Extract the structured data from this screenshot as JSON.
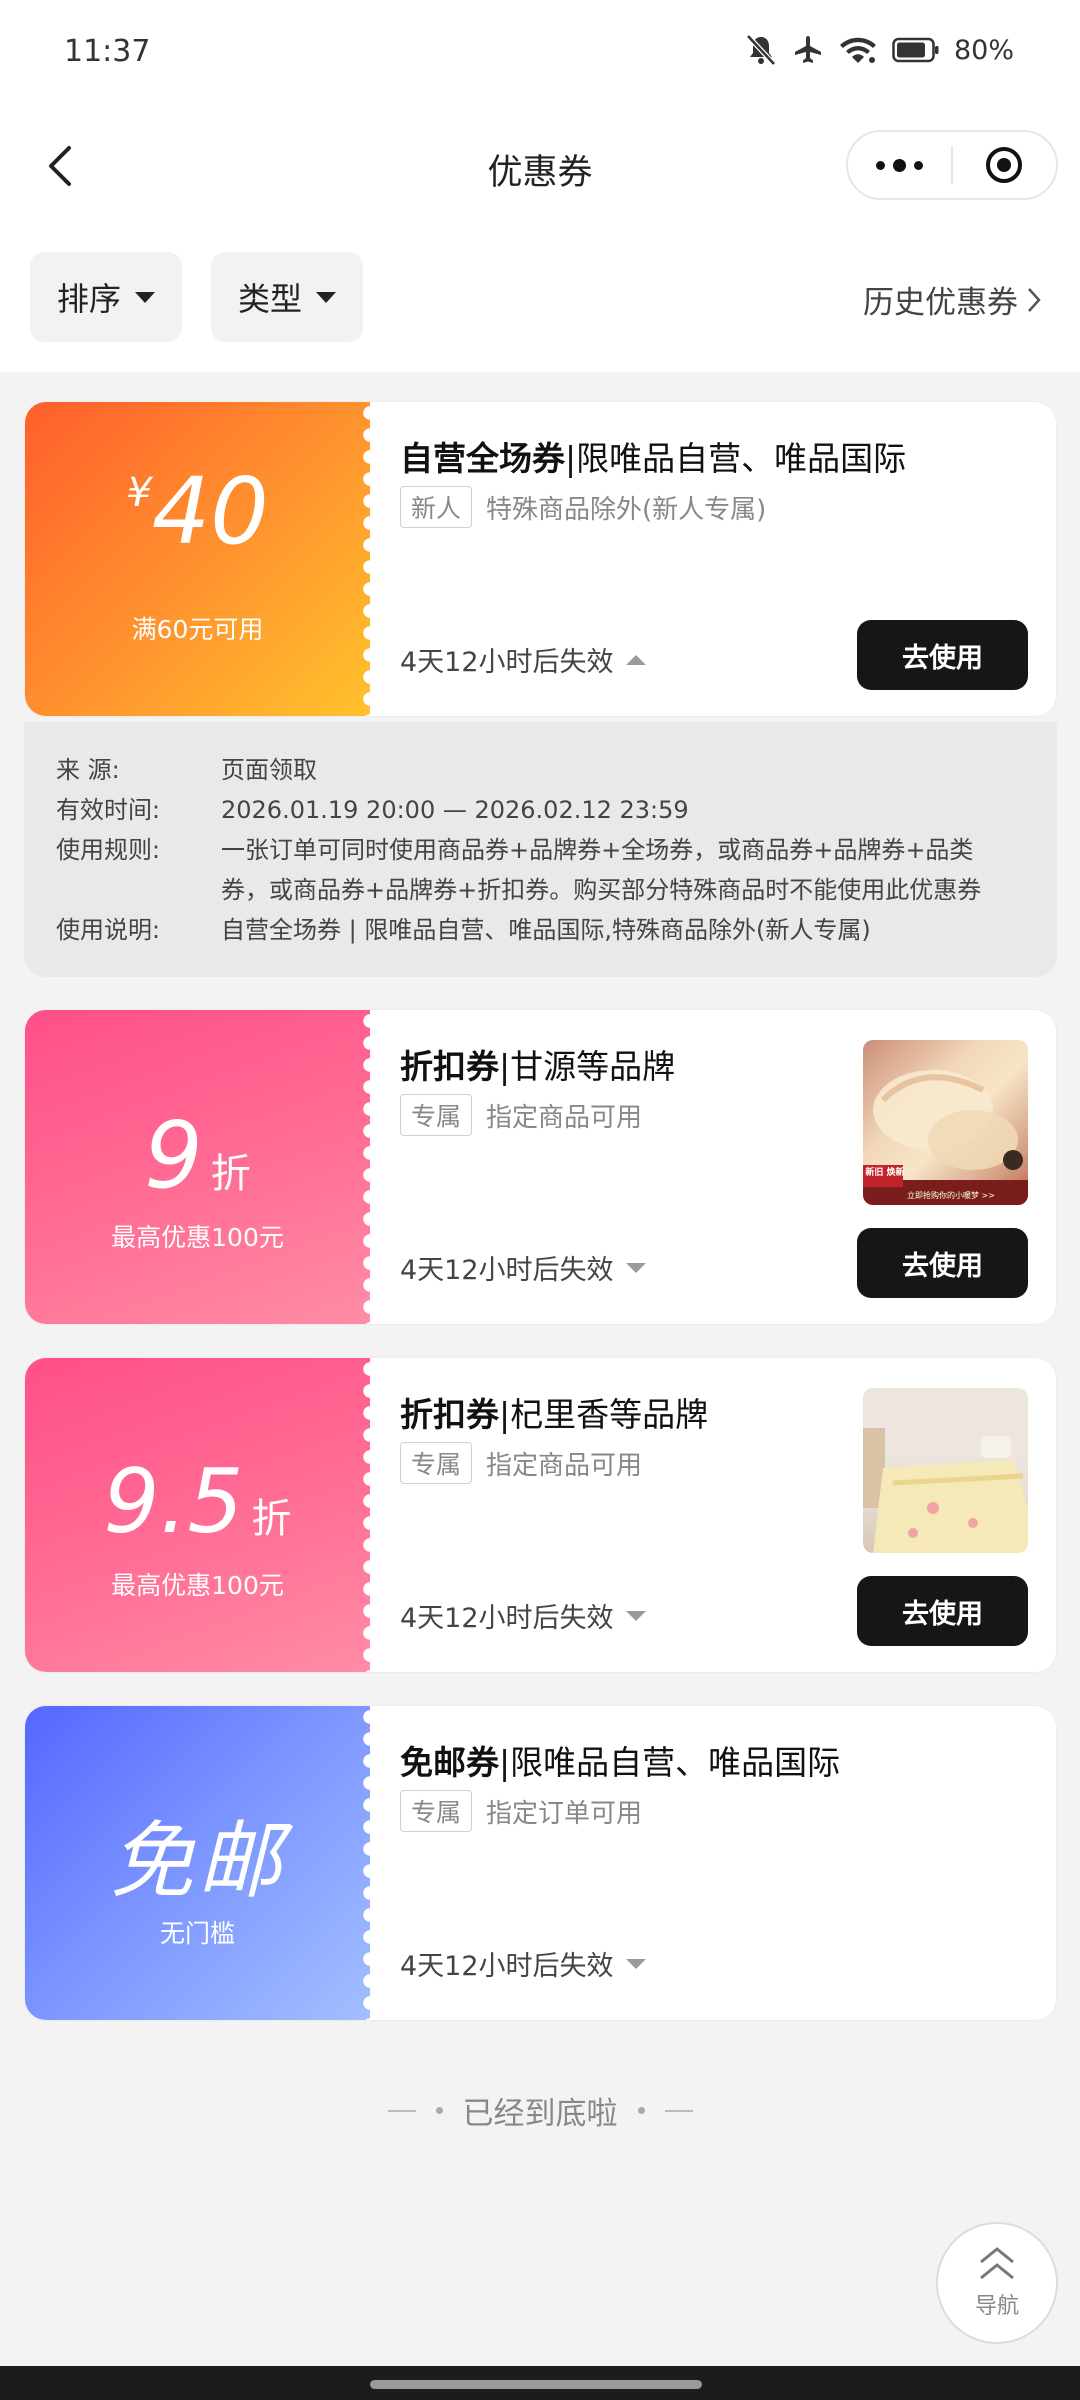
{
  "status_bar": {
    "time": "11:37",
    "battery": "80%",
    "icons": [
      "bell-muted-icon",
      "airplane-icon",
      "wifi-icon",
      "battery-icon"
    ]
  },
  "nav": {
    "title": "优惠券",
    "icons": [
      "back-icon",
      "more-icon",
      "close-target-icon"
    ]
  },
  "filters": {
    "sort_label": "排序",
    "type_label": "类型",
    "history_label": "历史优惠券"
  },
  "coupons": [
    {
      "currency": "¥",
      "value": "40",
      "condition": "满60元可用",
      "title_bold": "自营全场券",
      "title_rest": "|限唯品自营、唯品国际",
      "tag": "新人",
      "desc": "特殊商品除外(新人专属)",
      "expire": "4天12小时后失效",
      "button": "去使用",
      "colors": [
        "#ff6a2a",
        "#ffb62c"
      ]
    },
    {
      "value": "9",
      "unit": "折",
      "condition": "最高优惠100元",
      "title_bold": "折扣券",
      "title_rest": "|甘源等品牌",
      "tag": "专属",
      "desc": "指定商品可用",
      "expire": "4天12小时后失效",
      "button": "去使用",
      "thumb_badge": "新旧 焕新",
      "thumb_caption": "立即抢购你的小暖梦 >>",
      "colors": [
        "#ff4e88",
        "#ff8aa3"
      ]
    },
    {
      "value": "9.5",
      "unit": "折",
      "condition": "最高优惠100元",
      "title_bold": "折扣券",
      "title_rest": "|杞里香等品牌",
      "tag": "专属",
      "desc": "指定商品可用",
      "expire": "4天12小时后失效",
      "button": "去使用",
      "colors": [
        "#ff4e88",
        "#ff8aa3"
      ]
    },
    {
      "value": "免邮",
      "condition": "无门槛",
      "title_bold": "免邮券",
      "title_rest": "|限唯品自营、唯品国际",
      "tag": "专属",
      "desc": "指定订单可用",
      "expire": "4天12小时后失效",
      "colors": [
        "#5b73ff",
        "#93b2ff"
      ]
    }
  ],
  "details": {
    "source_label": "来 源:",
    "source_value": "页面领取",
    "valid_label": "有效时间:",
    "valid_value": "2026.01.19 20:00 — 2026.02.12 23:59",
    "rules_label": "使用规则:",
    "rules_value": "一张订单可同时使用商品券+品牌券+全场券，或商品券+品牌券+品类券，或商品券+品牌券+折扣券。购买部分特殊商品时不能使用此优惠券",
    "usage_label": "使用说明:",
    "usage_value": "自营全场券 | 限唯品自营、唯品国际,特殊商品除外(新人专属)"
  },
  "end_text": "已经到底啦",
  "float_nav_label": "导航"
}
